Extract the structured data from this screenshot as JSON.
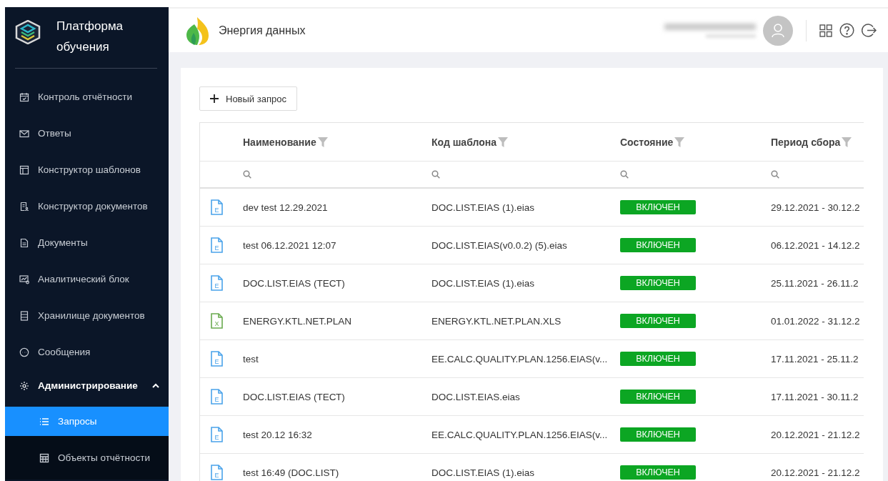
{
  "sidebar": {
    "title": "Платформа обучения",
    "items": [
      {
        "label": "Контроль отчётности",
        "selected": false
      },
      {
        "label": "Ответы",
        "selected": false
      },
      {
        "label": "Конструктор шаблонов",
        "selected": false
      },
      {
        "label": "Конструктор документов",
        "selected": false
      },
      {
        "label": "Документы",
        "selected": false
      },
      {
        "label": "Аналитический блок",
        "selected": false
      },
      {
        "label": "Хранилище документов",
        "selected": false
      },
      {
        "label": "Сообщения",
        "selected": false
      },
      {
        "label": "Администрирование",
        "selected": false,
        "expanded": true,
        "children": [
          {
            "label": "Запросы",
            "selected": true
          },
          {
            "label": "Объекты отчётности",
            "selected": false
          }
        ]
      }
    ]
  },
  "header": {
    "brand": "Энергия данных"
  },
  "toolbar": {
    "new_button": "Новый запрос"
  },
  "table": {
    "columns": [
      "Наименование",
      "Код шаблона",
      "Состояние",
      "Период сбора"
    ],
    "rows": [
      {
        "kind": "eias",
        "icon_letter": "E",
        "name": "dev test 12.29.2021",
        "template": "DOC.LIST.EIAS (1).eias",
        "status": "ВКЛЮЧЕН",
        "period": "29.12.2021 - 30.12.2"
      },
      {
        "kind": "eias",
        "icon_letter": "E",
        "name": "test 06.12.2021 12:07",
        "template": "DOC.LIST.EIAS(v0.0.2) (5).eias",
        "status": "ВКЛЮЧЕН",
        "period": "06.12.2021 - 14.12.2"
      },
      {
        "kind": "eias",
        "icon_letter": "E",
        "name": "DOC.LIST.EIAS (ТЕСТ)",
        "template": "DOC.LIST.EIAS (1).eias",
        "status": "ВКЛЮЧЕН",
        "period": "25.11.2021 - 26.11.2"
      },
      {
        "kind": "xls",
        "icon_letter": "X",
        "name": "ENERGY.KTL.NET.PLAN",
        "template": "ENERGY.KTL.NET.PLAN.XLS",
        "status": "ВКЛЮЧЕН",
        "period": "01.01.2022 - 31.12.2"
      },
      {
        "kind": "eias",
        "icon_letter": "E",
        "name": "test",
        "template": "EE.CALC.QUALITY.PLAN.1256.EIAS(v...",
        "status": "ВКЛЮЧЕН",
        "period": "17.11.2021 - 25.11.2"
      },
      {
        "kind": "eias",
        "icon_letter": "E",
        "name": "DOC.LIST.EIAS (ТЕСТ)",
        "template": "DOC.LIST.EIAS.eias",
        "status": "ВКЛЮЧЕН",
        "period": "17.11.2021 - 30.11.2"
      },
      {
        "kind": "eias",
        "icon_letter": "E",
        "name": "test 20.12 16:32",
        "template": "EE.CALC.QUALITY.PLAN.1256.EIAS(v...",
        "status": "ВКЛЮЧЕН",
        "period": "20.12.2021 - 21.12.2"
      },
      {
        "kind": "eias",
        "icon_letter": "E",
        "name": "test 16:49 (DOC.LIST)",
        "template": "DOC.LIST.EIAS (1).eias",
        "status": "ВКЛЮЧЕН",
        "period": "20.12.2021 - 21.12.2"
      }
    ]
  }
}
